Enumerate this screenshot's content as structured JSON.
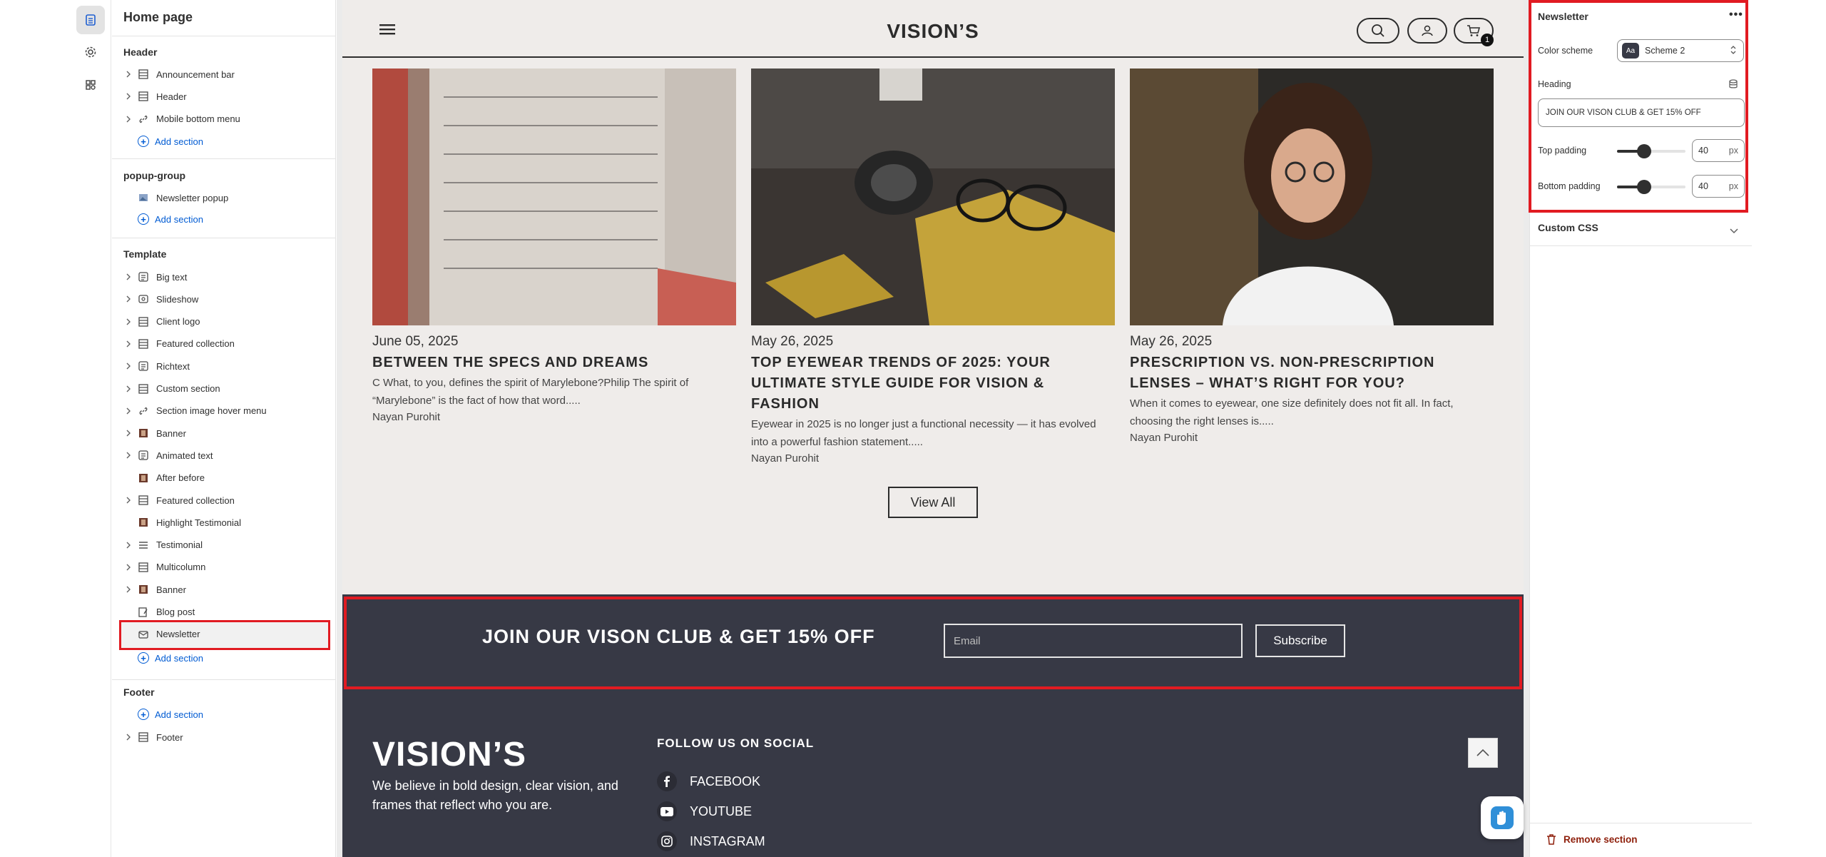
{
  "rail": {
    "icons": [
      "sections-icon",
      "settings-icon",
      "apps-icon"
    ]
  },
  "sidebar": {
    "title": "Home page",
    "add_section_label": "Add section",
    "header_group": {
      "title": "Header",
      "items": [
        {
          "label": "Announcement bar",
          "icon": "layout-icon"
        },
        {
          "label": "Header",
          "icon": "layout-icon"
        },
        {
          "label": "Mobile bottom menu",
          "icon": "link-icon"
        }
      ]
    },
    "popup_group": {
      "title": "popup-group",
      "items": [
        {
          "label": "Newsletter popup",
          "icon": "image-icon"
        }
      ]
    },
    "template_group": {
      "title": "Template",
      "items": [
        {
          "label": "Big text",
          "icon": "text-icon"
        },
        {
          "label": "Slideshow",
          "icon": "slideshow-icon"
        },
        {
          "label": "Client logo",
          "icon": "layout-icon"
        },
        {
          "label": "Featured collection",
          "icon": "layout-icon"
        },
        {
          "label": "Richtext",
          "icon": "text-icon"
        },
        {
          "label": "Custom section",
          "icon": "layout-icon"
        },
        {
          "label": "Section image hover menu",
          "icon": "link-icon"
        },
        {
          "label": "Banner",
          "icon": "photo-icon"
        },
        {
          "label": "Animated text",
          "icon": "text-icon"
        },
        {
          "label": "After before",
          "icon": "photo-icon"
        },
        {
          "label": "Featured collection",
          "icon": "layout-icon"
        },
        {
          "label": "Highlight Testimonial",
          "icon": "photo-icon"
        },
        {
          "label": "Testimonial",
          "icon": "list-icon"
        },
        {
          "label": "Multicolumn",
          "icon": "layout-icon"
        },
        {
          "label": "Banner",
          "icon": "photo-icon"
        },
        {
          "label": "Blog post",
          "icon": "blog-icon"
        },
        {
          "label": "Newsletter",
          "icon": "email-icon"
        }
      ]
    },
    "footer_group": {
      "title": "Footer",
      "items": [
        {
          "label": "Footer",
          "icon": "layout-icon"
        }
      ]
    }
  },
  "site": {
    "logo": "VISION’S",
    "cart_count": "1",
    "blog": [
      {
        "date": "June 05, 2025",
        "title": "BETWEEN THE SPECS AND DREAMS",
        "excerpt": "C What, to you, defines the spirit of Marylebone?Philip The spirit of “Marylebone” is the fact of how that word.....",
        "author": "Nayan Purohit"
      },
      {
        "date": "May 26, 2025",
        "title": "TOP EYEWEAR TRENDS OF 2025: YOUR ULTIMATE STYLE GUIDE FOR VISION & FASHION",
        "excerpt": "Eyewear in 2025 is no longer just a functional necessity — it has evolved into a powerful fashion statement.....",
        "author": "Nayan Purohit"
      },
      {
        "date": "May 26, 2025",
        "title": "PRESCRIPTION VS. NON-PRESCRIPTION LENSES – WHAT’S RIGHT FOR YOU?",
        "excerpt": "When it comes to eyewear, one size definitely does not fit all. In fact, choosing the right lenses is.....",
        "author": "Nayan Purohit"
      }
    ],
    "view_all": "View All",
    "newsletter": {
      "heading": "JOIN OUR VISON CLUB & GET 15% OFF",
      "email_placeholder": "Email",
      "subscribe": "Subscribe"
    },
    "footer": {
      "logo": "VISION’S",
      "tagline": "We believe in bold design, clear vision, and frames that reflect who you are.",
      "follow": "FOLLOW US ON SOCIAL",
      "social": [
        "FACEBOOK",
        "YOUTUBE",
        "INSTAGRAM"
      ]
    }
  },
  "settings": {
    "title": "Newsletter",
    "color_scheme_label": "Color scheme",
    "color_scheme_value": "Scheme 2",
    "color_scheme_chip": "Aa",
    "heading_label": "Heading",
    "heading_value": "JOIN OUR VISON CLUB & GET 15% OFF",
    "top_padding_label": "Top padding",
    "top_padding_value": "40",
    "bottom_padding_label": "Bottom padding",
    "bottom_padding_value": "40",
    "padding_level": 0.4,
    "unit": "px",
    "custom_css": "Custom CSS",
    "remove_section": "Remove section"
  },
  "colors": {
    "highlight": "#e11b22",
    "newsletter_bg": "#373945",
    "site_bg": "#efecea",
    "link_blue": "#005bd3",
    "remove_red": "#8e1f0b"
  }
}
